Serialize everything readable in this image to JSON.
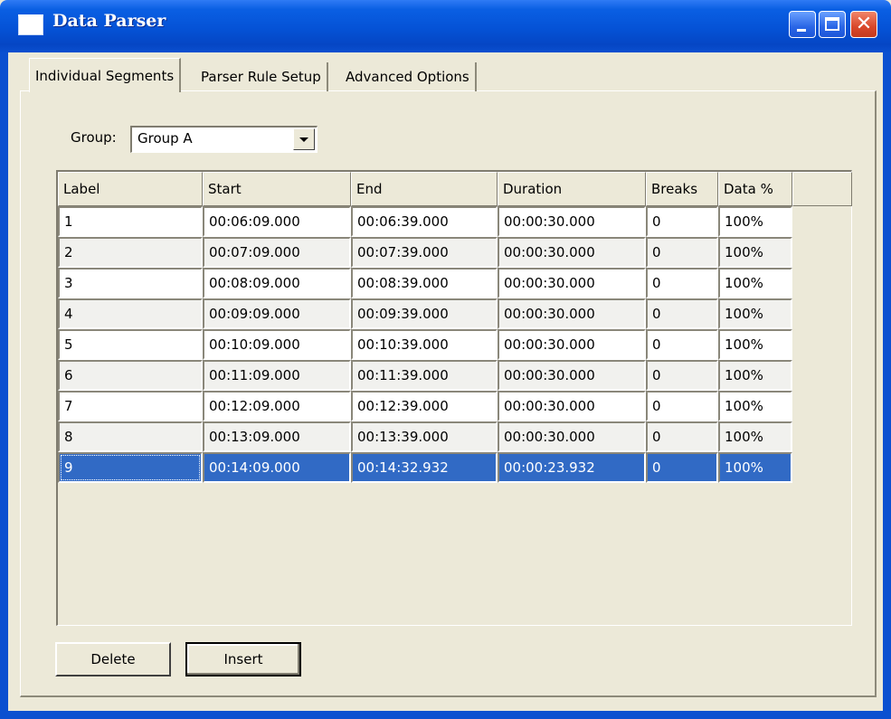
{
  "window": {
    "title": "Data Parser",
    "app_icon": "window-icon",
    "controls": [
      "minimize-icon",
      "maximize-icon",
      "close-icon"
    ],
    "title_bar_color": "#0552d6",
    "background_color": "#ece9d8"
  },
  "tabs": [
    {
      "label": "Individual Segments",
      "active": true
    },
    {
      "label": "Parser Rule Setup",
      "active": false
    },
    {
      "label": "Advanced Options",
      "active": false
    }
  ],
  "group": {
    "label": "Group:",
    "value": "Group A"
  },
  "table": {
    "columns": [
      "Label",
      "Start",
      "End",
      "Duration",
      "Breaks",
      "Data %"
    ],
    "rows": [
      [
        "1",
        "00:06:09.000",
        "00:06:39.000",
        "00:00:30.000",
        "0",
        "100%"
      ],
      [
        "2",
        "00:07:09.000",
        "00:07:39.000",
        "00:00:30.000",
        "0",
        "100%"
      ],
      [
        "3",
        "00:08:09.000",
        "00:08:39.000",
        "00:00:30.000",
        "0",
        "100%"
      ],
      [
        "4",
        "00:09:09.000",
        "00:09:39.000",
        "00:00:30.000",
        "0",
        "100%"
      ],
      [
        "5",
        "00:10:09.000",
        "00:10:39.000",
        "00:00:30.000",
        "0",
        "100%"
      ],
      [
        "6",
        "00:11:09.000",
        "00:11:39.000",
        "00:00:30.000",
        "0",
        "100%"
      ],
      [
        "7",
        "00:12:09.000",
        "00:12:39.000",
        "00:00:30.000",
        "0",
        "100%"
      ],
      [
        "8",
        "00:13:09.000",
        "00:13:39.000",
        "00:00:30.000",
        "0",
        "100%"
      ],
      [
        "9",
        "00:14:09.000",
        "00:14:32.932",
        "00:00:23.932",
        "0",
        "100%"
      ]
    ],
    "selected_row": 9,
    "selection_color": "#316ac5"
  },
  "buttons": {
    "delete_label": "Delete",
    "insert_label": "Insert"
  }
}
